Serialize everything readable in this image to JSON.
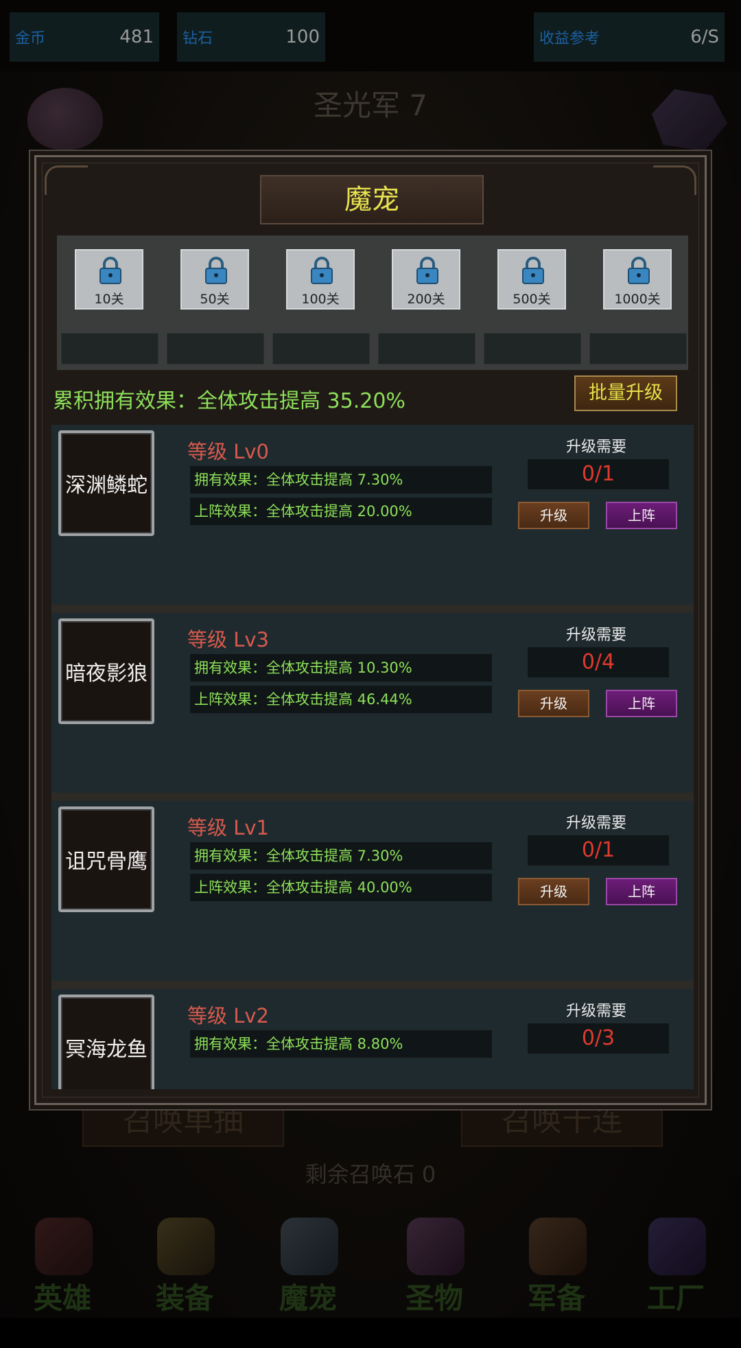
{
  "resources": {
    "gold_label": "金币",
    "gold_value": "481",
    "diamond_label": "钻石",
    "diamond_value": "100",
    "revenue_label": "收益参考",
    "revenue_value": "6/S"
  },
  "background": {
    "army_title": "圣光军 7",
    "summon_single": "召唤单抽",
    "summon_ten": "召唤十连",
    "remaining_stones": "剩余召唤石 0"
  },
  "nav": [
    {
      "label": "英雄",
      "icon": "hero-icon",
      "color": "#5a2a2a"
    },
    {
      "label": "装备",
      "icon": "equipment-sword-icon",
      "color": "#6a5a2a"
    },
    {
      "label": "魔宠",
      "icon": "pet-dragon-icon",
      "color": "#3d5060"
    },
    {
      "label": "圣物",
      "icon": "relic-icon",
      "color": "#5a3a5a"
    },
    {
      "label": "军备",
      "icon": "armament-icon",
      "color": "#5a4030"
    },
    {
      "label": "工厂",
      "icon": "factory-crystal-icon",
      "color": "#3a3060"
    }
  ],
  "modal": {
    "title": "魔宠",
    "milestones": [
      {
        "label": "10关",
        "icon": "lock-icon"
      },
      {
        "label": "50关",
        "icon": "lock-icon"
      },
      {
        "label": "100关",
        "icon": "lock-icon"
      },
      {
        "label": "200关",
        "icon": "lock-icon"
      },
      {
        "label": "500关",
        "icon": "lock-icon"
      },
      {
        "label": "1000关",
        "icon": "lock-icon"
      }
    ],
    "cumulative_effect": "累积拥有效果：全体攻击提高 35.20%",
    "batch_upgrade": "批量升级",
    "upgrade_req_label": "升级需要",
    "upgrade_btn": "升级",
    "deploy_btn": "上阵",
    "pets": [
      {
        "name": "深渊鳞蛇",
        "level": "等级 Lv0",
        "own_effect": "拥有效果：全体攻击提高 7.30%",
        "deploy_effect": "上阵效果：全体攻击提高 20.00%",
        "requirement": "0/1"
      },
      {
        "name": "暗夜影狼",
        "level": "等级 Lv3",
        "own_effect": "拥有效果：全体攻击提高 10.30%",
        "deploy_effect": "上阵效果：全体攻击提高 46.44%",
        "requirement": "0/4"
      },
      {
        "name": "诅咒骨鹰",
        "level": "等级 Lv1",
        "own_effect": "拥有效果：全体攻击提高 7.30%",
        "deploy_effect": "上阵效果：全体攻击提高 40.00%",
        "requirement": "0/1"
      },
      {
        "name": "冥海龙鱼",
        "level": "等级 Lv2",
        "own_effect": "拥有效果：全体攻击提高 8.80%",
        "deploy_effect": "",
        "requirement": "0/3"
      }
    ]
  }
}
